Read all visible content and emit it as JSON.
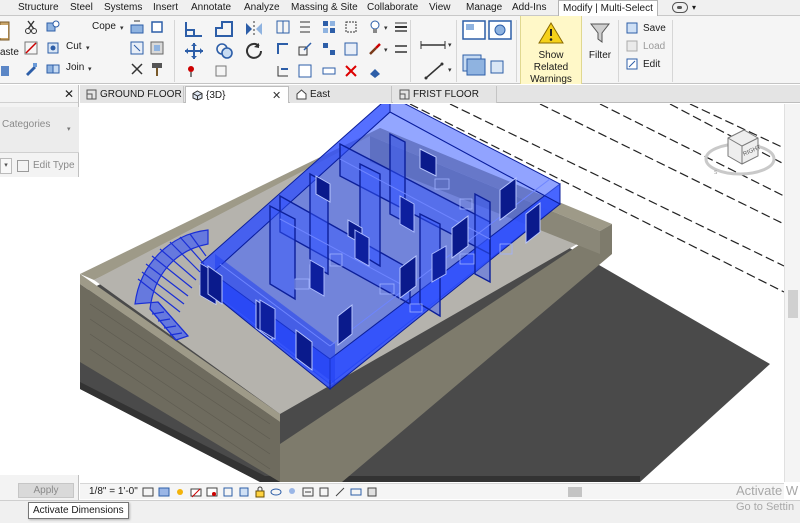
{
  "ribbon_tabs": [
    {
      "label": "Structure"
    },
    {
      "label": "Steel"
    },
    {
      "label": "Systems"
    },
    {
      "label": "Insert"
    },
    {
      "label": "Annotate"
    },
    {
      "label": "Analyze"
    },
    {
      "label": "Massing & Site"
    },
    {
      "label": "Collaborate"
    },
    {
      "label": "View"
    },
    {
      "label": "Manage"
    },
    {
      "label": "Add-Ins"
    },
    {
      "label": "Modify | Multi-Select",
      "active": true
    }
  ],
  "ribbon": {
    "paste_partial": "aste",
    "cope": "Cope",
    "cut": "Cut",
    "join": "Join",
    "show_related_warnings": "Show Related Warnings",
    "filter": "Filter",
    "save": "Save",
    "load": "Load",
    "edit": "Edit"
  },
  "properties": {
    "categories_placeholder": "Categories",
    "edit_type": "Edit Type",
    "apply": "Apply"
  },
  "view_tabs": [
    {
      "label": "GROUND FLOOR",
      "icon": "floor-plan-icon"
    },
    {
      "label": "{3D}",
      "icon": "3d-view-icon",
      "active": true
    },
    {
      "label": "East",
      "icon": "elevation-icon"
    },
    {
      "label": "FRIST FLOOR",
      "icon": "floor-plan-icon"
    }
  ],
  "view_control": {
    "scale": "1/8\" = 1'-0\""
  },
  "view_cube": {
    "face_label": "RIGHT"
  },
  "status": {
    "tooltip": "Activate Dimensions"
  },
  "watermark": {
    "line1": "Activate W",
    "line2": "Go to Settin"
  },
  "colors": {
    "selection_blue": "#2a4bff",
    "ground_dark": "#4a4a4a",
    "wall_gray": "#8a8a7a"
  }
}
